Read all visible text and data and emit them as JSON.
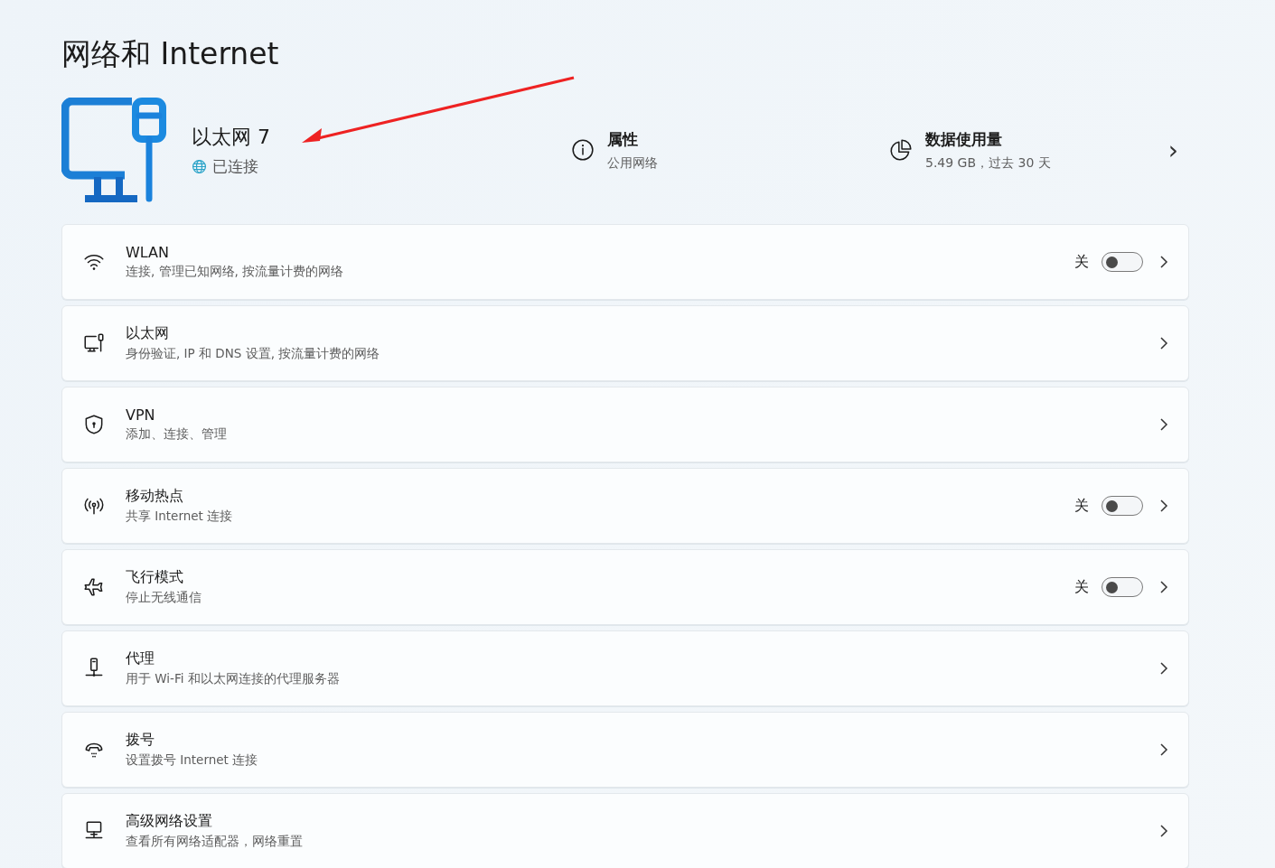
{
  "page_title": "网络和 Internet",
  "connection": {
    "name": "以太网 7",
    "status": "已连接"
  },
  "properties": {
    "title": "属性",
    "subtitle": "公用网络"
  },
  "data_usage": {
    "title": "数据使用量",
    "subtitle": "5.49 GB，过去 30 天",
    "chevron": "›"
  },
  "settings": [
    {
      "title": "WLAN",
      "subtitle": "连接, 管理已知网络, 按流量计费的网络",
      "toggle": {
        "label": "关",
        "on": false
      }
    },
    {
      "title": "以太网",
      "subtitle": "身份验证, IP 和 DNS 设置, 按流量计费的网络"
    },
    {
      "title": "VPN",
      "subtitle": "添加、连接、管理"
    },
    {
      "title": "移动热点",
      "subtitle": "共享 Internet 连接",
      "toggle": {
        "label": "关",
        "on": false
      }
    },
    {
      "title": "飞行模式",
      "subtitle": "停止无线通信",
      "toggle": {
        "label": "关",
        "on": false
      }
    },
    {
      "title": "代理",
      "subtitle": "用于 Wi-Fi 和以太网连接的代理服务器"
    },
    {
      "title": "拨号",
      "subtitle": "设置拨号 Internet 连接"
    },
    {
      "title": "高级网络设置",
      "subtitle": "查看所有网络适配器，网络重置"
    }
  ]
}
